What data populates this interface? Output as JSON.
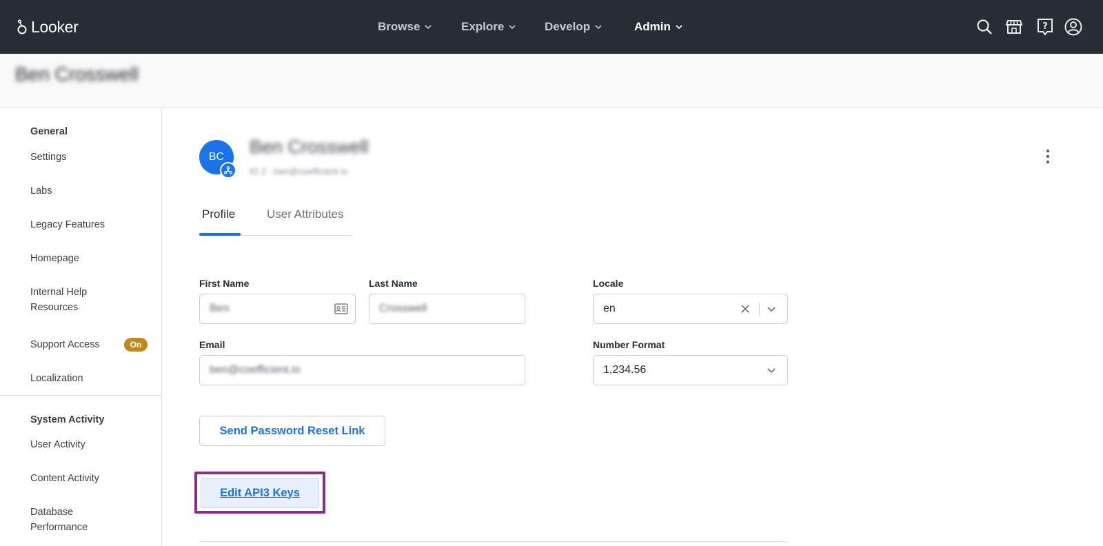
{
  "app": {
    "name": "Looker"
  },
  "nav": {
    "items": [
      {
        "label": "Browse"
      },
      {
        "label": "Explore"
      },
      {
        "label": "Develop"
      },
      {
        "label": "Admin",
        "active": true
      }
    ],
    "icons": [
      "search-icon",
      "marketplace-icon",
      "help-icon",
      "account-icon"
    ]
  },
  "page": {
    "user_name": "Ben Crosswell"
  },
  "sidebar": {
    "general_heading": "General",
    "general_items": [
      {
        "label": "Settings"
      },
      {
        "label": "Labs"
      },
      {
        "label": "Legacy Features"
      },
      {
        "label": "Homepage"
      },
      {
        "label": "Internal Help Resources"
      },
      {
        "label": "Support Access",
        "badge": "On"
      },
      {
        "label": "Localization"
      }
    ],
    "system_heading": "System Activity",
    "system_items": [
      {
        "label": "User Activity"
      },
      {
        "label": "Content Activity"
      },
      {
        "label": "Database Performance"
      }
    ]
  },
  "user": {
    "initials": "BC",
    "full_name": "Ben Crosswell",
    "subtitle": "ID 2 · ben@coefficient.io"
  },
  "tabs": [
    {
      "label": "Profile",
      "active": true
    },
    {
      "label": "User Attributes"
    }
  ],
  "form": {
    "first_name": {
      "label": "First Name",
      "value": "Ben"
    },
    "last_name": {
      "label": "Last Name",
      "value": "Crosswell"
    },
    "email": {
      "label": "Email",
      "value": "ben@coefficient.io"
    },
    "locale": {
      "label": "Locale",
      "value": "en"
    },
    "number_format": {
      "label": "Number Format",
      "value": "1,234.56"
    }
  },
  "actions": {
    "reset_password": "Send Password Reset Link",
    "edit_api_keys": "Edit API3 Keys"
  },
  "colors": {
    "topbar": "#262d33",
    "accent": "#1a73e8",
    "badge": "#c0891b",
    "highlight": "#8a2c8a"
  }
}
